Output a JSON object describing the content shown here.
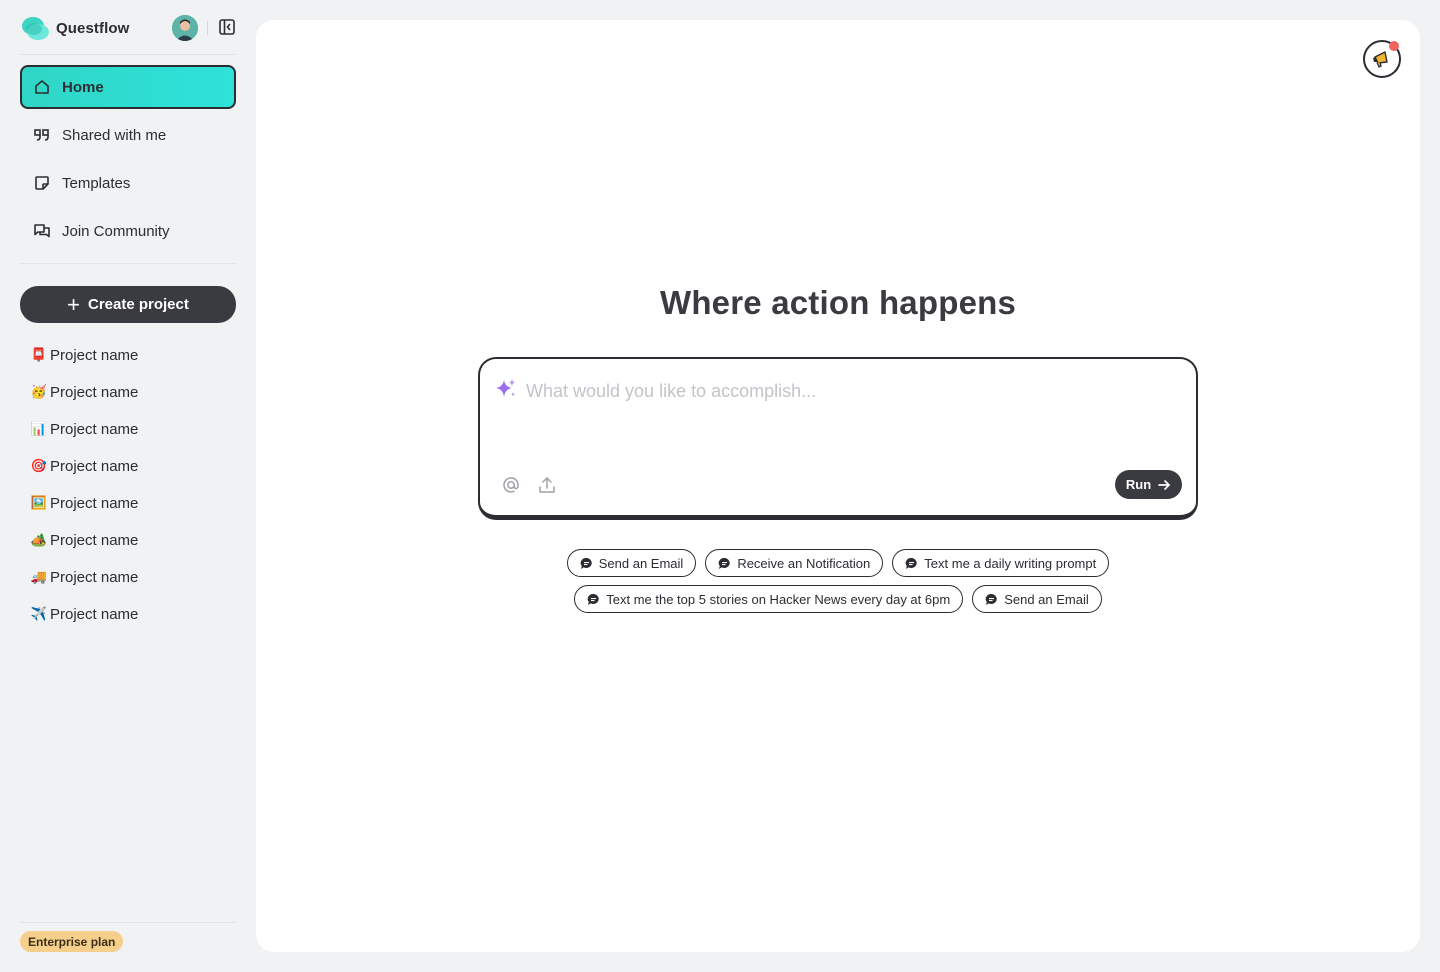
{
  "app": {
    "name": "Questflow"
  },
  "sidebar": {
    "nav": [
      {
        "label": "Home",
        "icon": "home-icon",
        "active": true
      },
      {
        "label": "Shared with me",
        "icon": "quote-icon"
      },
      {
        "label": "Templates",
        "icon": "sticky-note-icon"
      },
      {
        "label": "Join Community",
        "icon": "chat-bubbles-icon"
      }
    ],
    "create_label": "Create project",
    "projects": [
      {
        "emoji": "📮",
        "label": "Project name"
      },
      {
        "emoji": "🥳",
        "label": "Project name"
      },
      {
        "emoji": "📊",
        "label": "Project name"
      },
      {
        "emoji": "🎯",
        "label": "Project name"
      },
      {
        "emoji": "🖼️",
        "label": "Project name"
      },
      {
        "emoji": "🏕️",
        "label": "Project name"
      },
      {
        "emoji": "🚚",
        "label": "Project name"
      },
      {
        "emoji": "✈️",
        "label": "Project name"
      }
    ],
    "plan_badge": "Enterprise plan"
  },
  "main": {
    "headline": "Where action happens",
    "prompt_placeholder": "What would you like to accomplish...",
    "run_label": "Run",
    "suggestions_row1": [
      "Send an Email",
      "Receive an Notification",
      "Text me a daily writing prompt"
    ],
    "suggestions_row2": [
      "Text me the top 5 stories on Hacker News every day at 6pm",
      "Send an Email"
    ]
  },
  "colors": {
    "accent": "#2fd6c5",
    "dark": "#3a3b41",
    "badge": "#f7cf8c",
    "notification_dot": "#f0625a",
    "sparkle": "#9b6cf0"
  }
}
